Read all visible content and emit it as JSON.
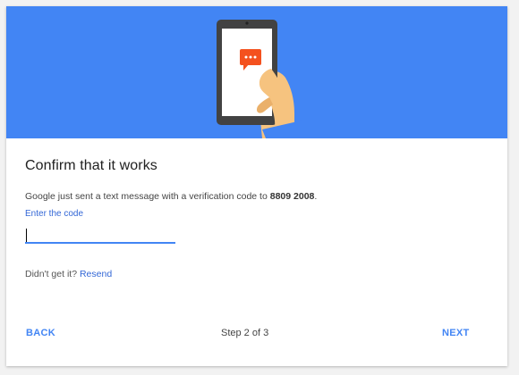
{
  "dialog": {
    "title": "Confirm that it works",
    "description_prefix": "Google just sent a text message with a verification code to ",
    "phone_number": "8809 2008",
    "description_suffix": ".",
    "code_label": "Enter the code",
    "code_value": "",
    "resend_prefix": "Didn't get it? ",
    "resend_link": "Resend"
  },
  "footer": {
    "back_label": "BACK",
    "step_text": "Step 2 of 3",
    "next_label": "NEXT"
  },
  "hero": {
    "background_color": "#4285f4",
    "message_bubble_color": "#f4511e",
    "illustration": "phone-in-hand-illustration"
  },
  "colors": {
    "accent": "#4285f4",
    "link": "#3367d6"
  }
}
